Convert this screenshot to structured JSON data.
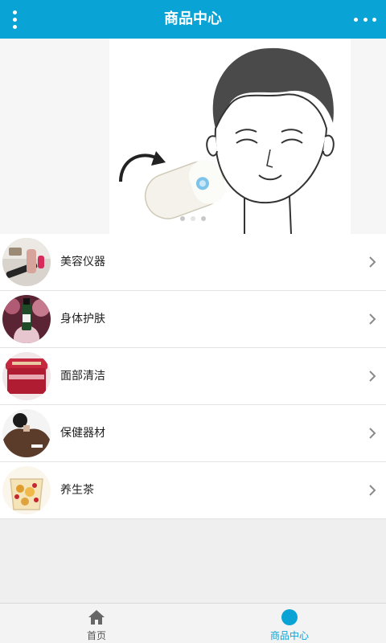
{
  "header": {
    "title": "商品中心",
    "menu_icon": "vertical-dots-icon",
    "more_icon": "horizontal-dots-icon",
    "color": "#0aa3d6"
  },
  "banner": {
    "description_icon": "face-massager-illustration",
    "slides": 3,
    "active_slide": 2
  },
  "categories": [
    {
      "label": "美容仪器",
      "icon": "beauty-device-thumbnail"
    },
    {
      "label": "身体护肤",
      "icon": "body-care-thumbnail"
    },
    {
      "label": "面部清洁",
      "icon": "facial-cleansing-thumbnail"
    },
    {
      "label": "保健器材",
      "icon": "health-equipment-thumbnail"
    },
    {
      "label": "养生茶",
      "icon": "health-tea-thumbnail"
    }
  ],
  "bottom_nav": {
    "items": [
      {
        "label": "首页",
        "icon": "home-icon",
        "active": false
      },
      {
        "label": "商品中心",
        "icon": "circle-icon",
        "active": true
      }
    ]
  }
}
